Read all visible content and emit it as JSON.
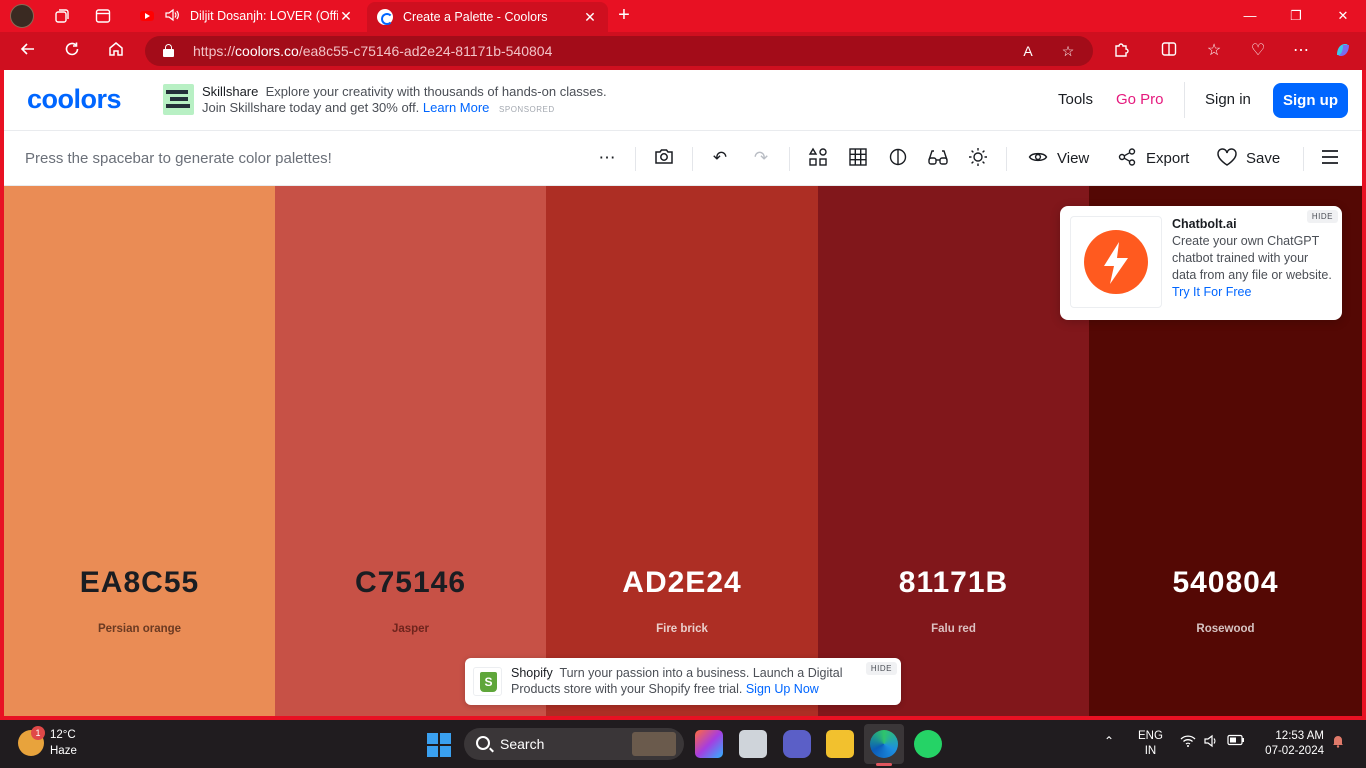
{
  "browser": {
    "tabs": [
      {
        "title": "Diljit Dosanjh: LOVER (Offici",
        "active": false
      },
      {
        "title": "Create a Palette - Coolors",
        "active": true
      }
    ],
    "url_prefix": "https://",
    "url_host": "coolors.co",
    "url_path": "/ea8c55-c75146-ad2e24-81171b-540804"
  },
  "header": {
    "logo": "coolors",
    "ad": {
      "brand": "Skillshare",
      "text": "Explore your creativity with thousands of hands-on classes. Join Skillshare today and get 30% off.",
      "cta": "Learn More",
      "sponsored": "SPONSORED"
    },
    "tools": "Tools",
    "gopro": "Go Pro",
    "signin": "Sign in",
    "signup": "Sign up"
  },
  "toolbar": {
    "hint": "Press the spacebar to generate color palettes!",
    "view": "View",
    "export": "Export",
    "save": "Save"
  },
  "palette": [
    {
      "hex": "EA8C55",
      "name": "Persian orange",
      "color": "#EA8C55",
      "text_color": "#1a1d22",
      "name_color": "#6b3a22"
    },
    {
      "hex": "C75146",
      "name": "Jasper",
      "color": "#C75146",
      "text_color": "#1a1d22",
      "name_color": "#6e241d"
    },
    {
      "hex": "AD2E24",
      "name": "Fire brick",
      "color": "#AD2E24",
      "text_color": "#ffffff",
      "name_color": "#ead0cc"
    },
    {
      "hex": "81171B",
      "name": "Falu red",
      "color": "#81171B",
      "text_color": "#ffffff",
      "name_color": "#dcc0c1"
    },
    {
      "hex": "540804",
      "name": "Rosewood",
      "color": "#540804",
      "text_color": "#ffffff",
      "name_color": "#d6c3c2"
    }
  ],
  "chatbolt_ad": {
    "title": "Chatbolt.ai",
    "text": "Create your own ChatGPT chatbot trained with your data from any file or website.",
    "cta": "Try It For Free",
    "hide": "HIDE"
  },
  "shopify_ad": {
    "brand": "Shopify",
    "text": "Turn your passion into a business. Launch a Digital Products store with your Shopify free trial.",
    "cta": "Sign Up Now",
    "hide": "HIDE"
  },
  "taskbar": {
    "weather_badge": "1",
    "temperature": "12°C",
    "weather": "Haze",
    "search": "Search",
    "lang1": "ENG",
    "lang2": "IN",
    "time": "12:53 AM",
    "date": "07-02-2024"
  }
}
